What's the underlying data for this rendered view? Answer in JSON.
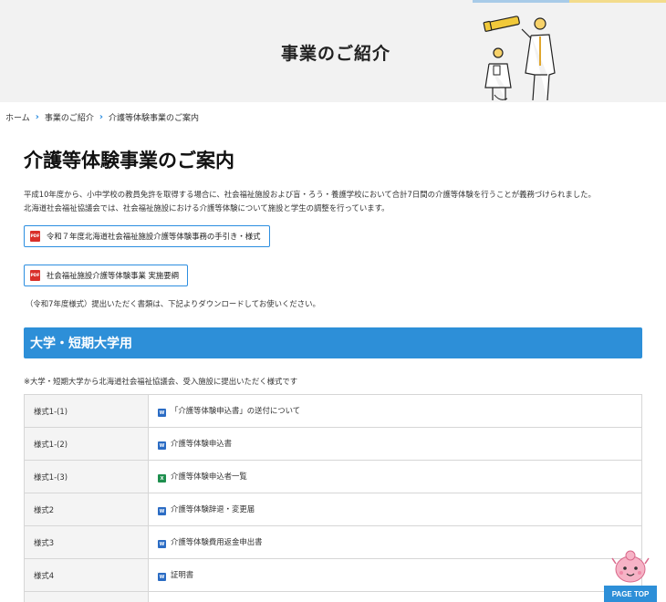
{
  "hero": {
    "title": "事業のご紹介"
  },
  "breadcrumb": [
    {
      "label": "ホーム"
    },
    {
      "label": "事業のご紹介"
    },
    {
      "label": "介護等体験事業のご案内"
    }
  ],
  "page": {
    "title": "介護等体験事業のご案内",
    "intro_line1": "平成10年度から、小中学校の教員免許を取得する場合に、社会福祉施設および盲・ろう・養護学校において合計7日間の介護等体験を行うことが義務づけられました。",
    "intro_line2": "北海道社会福祉協議会では、社会福祉施設における介護等体験について施設と学生の調整を行っています。"
  },
  "documents": [
    {
      "icon": "pdf-icon",
      "icon_text": "PDF",
      "label": "令和７年度北海道社会福祉施設介護等体験事務の手引き・様式"
    },
    {
      "icon": "pdf-icon",
      "icon_text": "PDF",
      "label": "社会福祉施設介護等体験事業 実施要綱"
    }
  ],
  "download_note": "（令和7年度様式）提出いただく書類は、下記よりダウンロードしてお使いください。",
  "section": {
    "title": "大学・短期大学用",
    "note": "※大学・短期大学から北海道社会福祉協議会、受入施設に提出いただく様式です",
    "rows": [
      {
        "name": "様式1-(1)",
        "icon": "word-icon",
        "icon_text": "W",
        "doc": "「介護等体験申込書」の送付について"
      },
      {
        "name": "様式1-(2)",
        "icon": "word-icon",
        "icon_text": "W",
        "doc": "介護等体験申込書"
      },
      {
        "name": "様式1-(3)",
        "icon": "excel-icon",
        "icon_text": "X",
        "doc": "介護等体験申込者一覧"
      },
      {
        "name": "様式2",
        "icon": "word-icon",
        "icon_text": "W",
        "doc": "介護等体験辞退・変更届"
      },
      {
        "name": "様式3",
        "icon": "word-icon",
        "icon_text": "W",
        "doc": "介護等体験費用返金申出書"
      },
      {
        "name": "様式4",
        "icon": "word-icon",
        "icon_text": "W",
        "doc": "証明書"
      },
      {
        "name": "",
        "icon": "",
        "icon_text": "",
        "doc": ""
      }
    ]
  },
  "page_top": {
    "label": "PAGE TOP"
  },
  "colors": {
    "accent": "#2d8fd8",
    "pdf": "#d9302a",
    "word": "#2b6cc4",
    "excel": "#1e8f4e",
    "hero_bg": "#f2f2f2",
    "table_header_bg": "#f4f4f4",
    "border": "#d6d6d6"
  }
}
